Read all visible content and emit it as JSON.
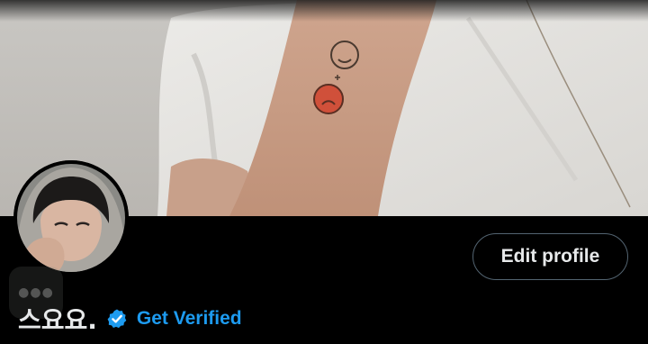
{
  "profile": {
    "display_name": "스요요.",
    "get_verified_label": "Get Verified",
    "edit_profile_label": "Edit profile"
  },
  "images": {
    "banner": "header-photo",
    "avatar": "profile-photo"
  },
  "icons": {
    "verified": "verified-badge-icon",
    "more": "more-dots-icon"
  },
  "colors": {
    "background": "#000000",
    "text_primary": "#e7e9ea",
    "accent": "#1d9bf0",
    "button_border": "#536471"
  }
}
